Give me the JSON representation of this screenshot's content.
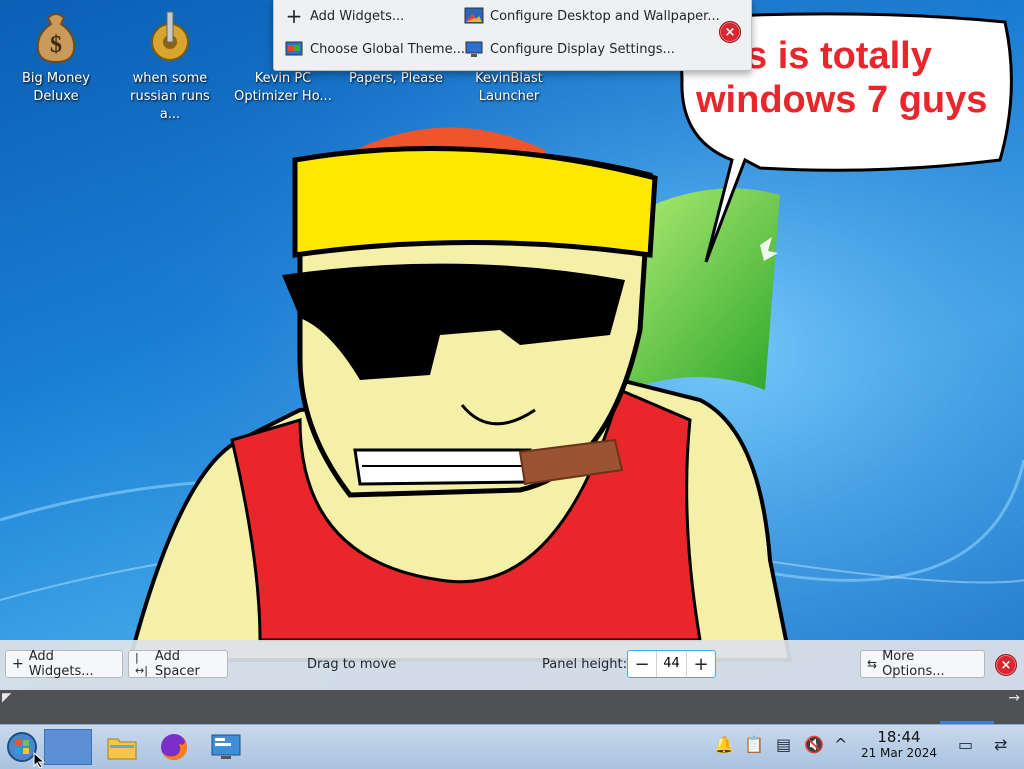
{
  "desktop": {
    "icons": [
      {
        "label": "Big Money Deluxe",
        "icon": "money-bag-icon"
      },
      {
        "label": "when some russian runs a...",
        "icon": "gear-icon"
      },
      {
        "label": "Kevin PC Optimizer Ho...",
        "icon": "disc-icon"
      },
      {
        "label": "Papers, Please",
        "icon": "app-icon"
      },
      {
        "label": "KevinBlast Launcher",
        "icon": "app-icon"
      }
    ],
    "speech_bubble_text": "s is totally windows 7 guys"
  },
  "context_menu": {
    "items": [
      {
        "label": "Add Widgets...",
        "icon": "plus-icon"
      },
      {
        "label": "Configure Desktop and Wallpaper...",
        "icon": "wallpaper-icon"
      },
      {
        "label": "Choose Global Theme...",
        "icon": "theme-icon"
      },
      {
        "label": "Configure Display Settings...",
        "icon": "display-icon"
      }
    ]
  },
  "panel_edit": {
    "add_widgets": "Add Widgets...",
    "add_spacer": "Add Spacer",
    "drag_to_move": "Drag to move",
    "panel_height_label": "Panel height:",
    "panel_height_value": "44",
    "more_options": "More Options..."
  },
  "taskbar": {
    "clock_time": "18:44",
    "clock_date": "21 Mar 2024",
    "apps": [
      "start-orb-icon",
      "task-thumbnail",
      "file-manager-icon",
      "firefox-icon",
      "system-settings-icon"
    ],
    "tray": [
      "notifications-icon",
      "clipboard-icon",
      "disk-icon",
      "volume-muted-icon",
      "chevron-up-icon",
      "show-desktop-icon",
      "panel-settings-icon"
    ]
  },
  "colors": {
    "accent": "#3daee9",
    "close_red": "#d9262f",
    "taskbar": "#b8cfe8"
  }
}
